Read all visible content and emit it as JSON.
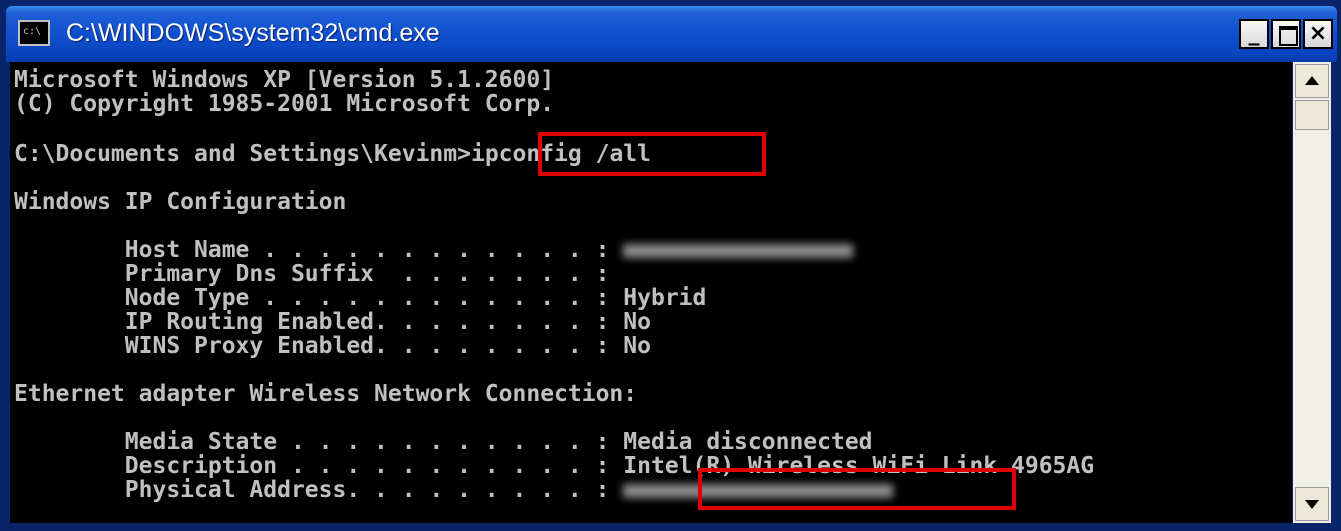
{
  "window": {
    "title": "C:\\WINDOWS\\system32\\cmd.exe",
    "icon": "console-icon",
    "icon_text": "c:\\",
    "minimize_label": "_",
    "close_label": "×"
  },
  "console": {
    "header_line1": "Microsoft Windows XP [Version 5.1.2600]",
    "header_line2": "(C) Copyright 1985-2001 Microsoft Corp.",
    "prompt": "C:\\Documents and Settings\\Kevinm>",
    "command": "ipconfig /all",
    "section1_title": "Windows IP Configuration",
    "section1": [
      {
        "label": "        Host Name . . . . . . . . . . . . : ",
        "value": ""
      },
      {
        "label": "        Primary Dns Suffix  . . . . . . . : ",
        "value": ""
      },
      {
        "label": "        Node Type . . . . . . . . . . . . : ",
        "value": "Hybrid"
      },
      {
        "label": "        IP Routing Enabled. . . . . . . . : ",
        "value": "No"
      },
      {
        "label": "        WINS Proxy Enabled. . . . . . . . : ",
        "value": "No"
      }
    ],
    "section2_title": "Ethernet adapter Wireless Network Connection:",
    "section2": [
      {
        "label": "        Media State . . . . . . . . . . . : ",
        "value": "Media disconnected"
      },
      {
        "label": "        Description . . . . . . . . . . . : ",
        "value": "Intel(R) Wireless WiFi Link 4965AG"
      },
      {
        "label": "        Physical Address. . . . . . . . . : ",
        "value": ""
      }
    ]
  },
  "colors": {
    "highlight": "#e00000",
    "console_bg": "#000000",
    "console_text": "#c0c0c0"
  }
}
